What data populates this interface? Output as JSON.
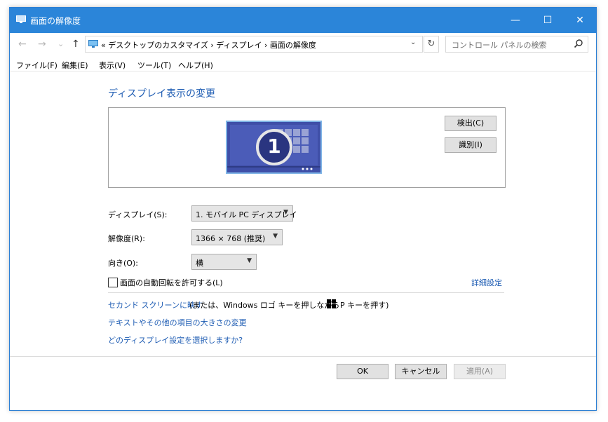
{
  "window": {
    "title": "画面の解像度",
    "controls": {
      "minimize": "—",
      "maximize": "☐",
      "close": "✕"
    }
  },
  "nav": {
    "back_icon": "←",
    "forward_icon": "→",
    "dropdown_icon": "⌄",
    "up_icon": "↑",
    "breadcrumb": "«  デスクトップのカスタマイズ  ›  ディスプレイ  ›  画面の解像度",
    "address_drop_icon": "⌄",
    "refresh_icon": "↻",
    "search_placeholder": "コントロール パネルの検索"
  },
  "menu": [
    "ファイル(F)",
    "編集(E)",
    "表示(V)",
    "ツール(T)",
    "ヘルプ(H)"
  ],
  "main": {
    "heading": "ディスプレイ表示の変更",
    "monitor_number": "1",
    "detect_button": "検出(C)",
    "identify_button": "識別(I)",
    "display_label": "ディスプレイ(S):",
    "display_value": "1. モバイル PC ディスプレイ",
    "resolution_label": "解像度(R):",
    "resolution_value": "1366 × 768 (推奨)",
    "orientation_label": "向き(O):",
    "orientation_value": "横",
    "auto_rotate_label": "画面の自動回転を許可する(L)",
    "advanced_link": "詳細設定",
    "second_screen_link": "セカンド スクリーンに映す",
    "second_screen_hint_1": "(または、Windows ロゴ キーを押しながら",
    "second_screen_hint_2": "P キーを押す)",
    "text_size_link": "テキストやその他の項目の大きさの変更",
    "which_settings_link": "どのディスプレイ設定を選択しますか?"
  },
  "footer": {
    "ok": "OK",
    "cancel": "キャンセル",
    "apply": "適用(A)"
  },
  "colors": {
    "titlebar": "#2b85d9",
    "link": "#1e5cb3",
    "monitor_fill": "#3f4fa8",
    "disabled_text": "#8a8a8a"
  }
}
